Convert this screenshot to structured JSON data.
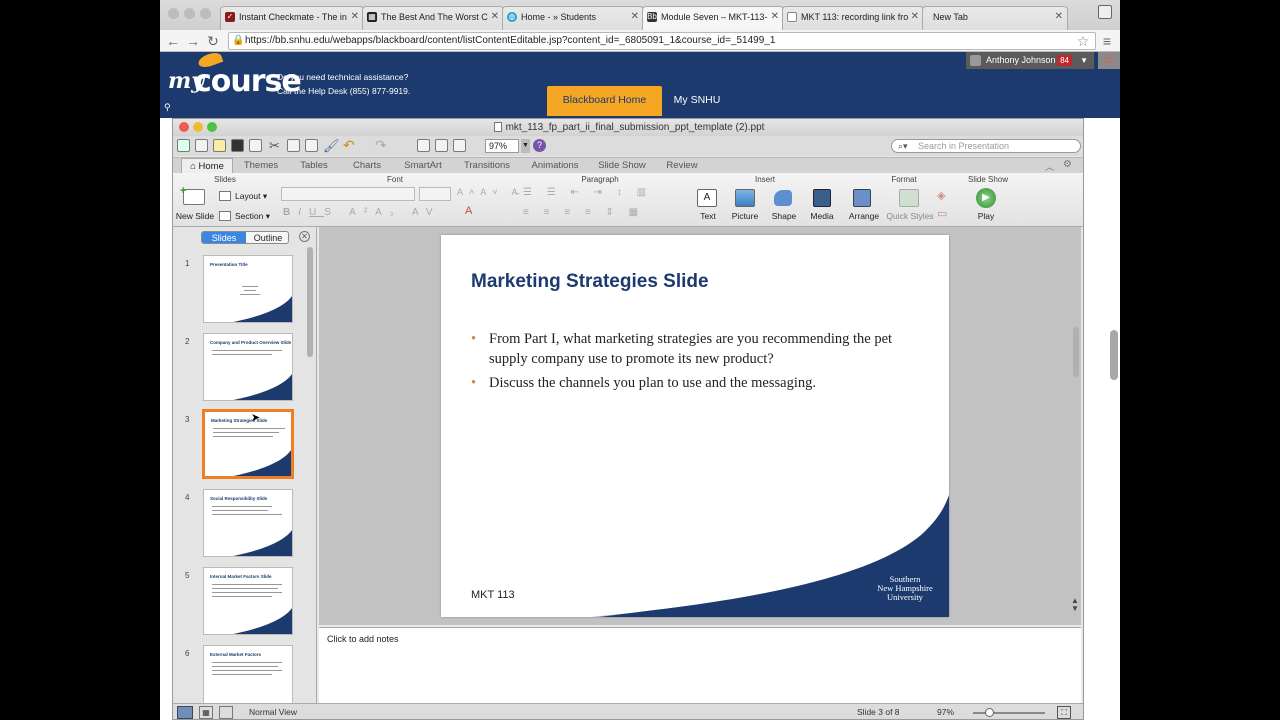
{
  "browser": {
    "tabs": [
      {
        "label": "Instant Checkmate - The in",
        "icon": "checkmate-favicon-icon",
        "color": "#8b1a1a"
      },
      {
        "label": "The Best And The Worst C",
        "icon": "grid-favicon-icon",
        "color": "#222222"
      },
      {
        "label": "Home - » Students",
        "icon": "globe-favicon-icon",
        "color": "#1fa2c9"
      },
      {
        "label": "Module Seven – MKT-113-",
        "icon": "blackboard-favicon-icon",
        "color": "#333333"
      },
      {
        "label": "MKT 113: recording link fro",
        "icon": "document-favicon-icon",
        "color": "#888888"
      },
      {
        "label": "New Tab",
        "icon": "",
        "color": ""
      }
    ],
    "url": "https://bb.snhu.edu/webapps/blackboard/content/listContentEditable.jsp?content_id=_6805091_1&course_id=_51499_1"
  },
  "blackboard": {
    "logo_my": "my",
    "logo_course": "course",
    "help_line1": "Do you need technical assistance?",
    "help_line2": "Call the Help Desk (855) 877-9919.",
    "nav_home": "Blackboard Home",
    "nav_snhu": "My SNHU",
    "user_name": "Anthony Johnson",
    "notification_count": "84",
    "accent_color": "#f5a623",
    "brand_color": "#1c3a6e"
  },
  "ppt": {
    "window_title": "mkt_113_fp_part_ii_final_submission_ppt_template (2).ppt",
    "zoom": "97%",
    "search_placeholder": "Search in Presentation",
    "ribbon_tabs": [
      "Home",
      "Themes",
      "Tables",
      "Charts",
      "SmartArt",
      "Transitions",
      "Animations",
      "Slide Show",
      "Review"
    ],
    "groups": {
      "slides": "Slides",
      "font": "Font",
      "paragraph": "Paragraph",
      "insert": "Insert",
      "format": "Format",
      "slideshow": "Slide Show"
    },
    "buttons": {
      "new_slide": "New Slide",
      "layout": "Layout",
      "section": "Section",
      "text": "Text",
      "picture": "Picture",
      "shape": "Shape",
      "media": "Media",
      "arrange": "Arrange",
      "quick_styles": "Quick Styles",
      "play": "Play"
    },
    "panel_tabs": {
      "slides": "Slides",
      "outline": "Outline"
    },
    "thumbnails": [
      {
        "num": "1",
        "title": "Presentation Title"
      },
      {
        "num": "2",
        "title": "Company and Product Overview Slide"
      },
      {
        "num": "3",
        "title": "Marketing Strategies Slide"
      },
      {
        "num": "4",
        "title": "Social Responsibility Slide"
      },
      {
        "num": "5",
        "title": "Internal Market Factors Slide"
      },
      {
        "num": "6",
        "title": "External Market Factors"
      }
    ],
    "slide": {
      "title": "Marketing Strategies Slide",
      "bullet1": "From Part I, what marketing strategies are you recommending the pet supply company use to promote its new product?",
      "bullet2": "Discuss the channels you plan to use and the messaging.",
      "footer": "MKT 113",
      "logo_line1": "Southern",
      "logo_line2": "New Hampshire",
      "logo_line3": "University"
    },
    "notes_placeholder": "Click to add notes",
    "status": {
      "view": "Normal View",
      "slide_of": "Slide 3 of 8",
      "zoom": "97%"
    }
  }
}
